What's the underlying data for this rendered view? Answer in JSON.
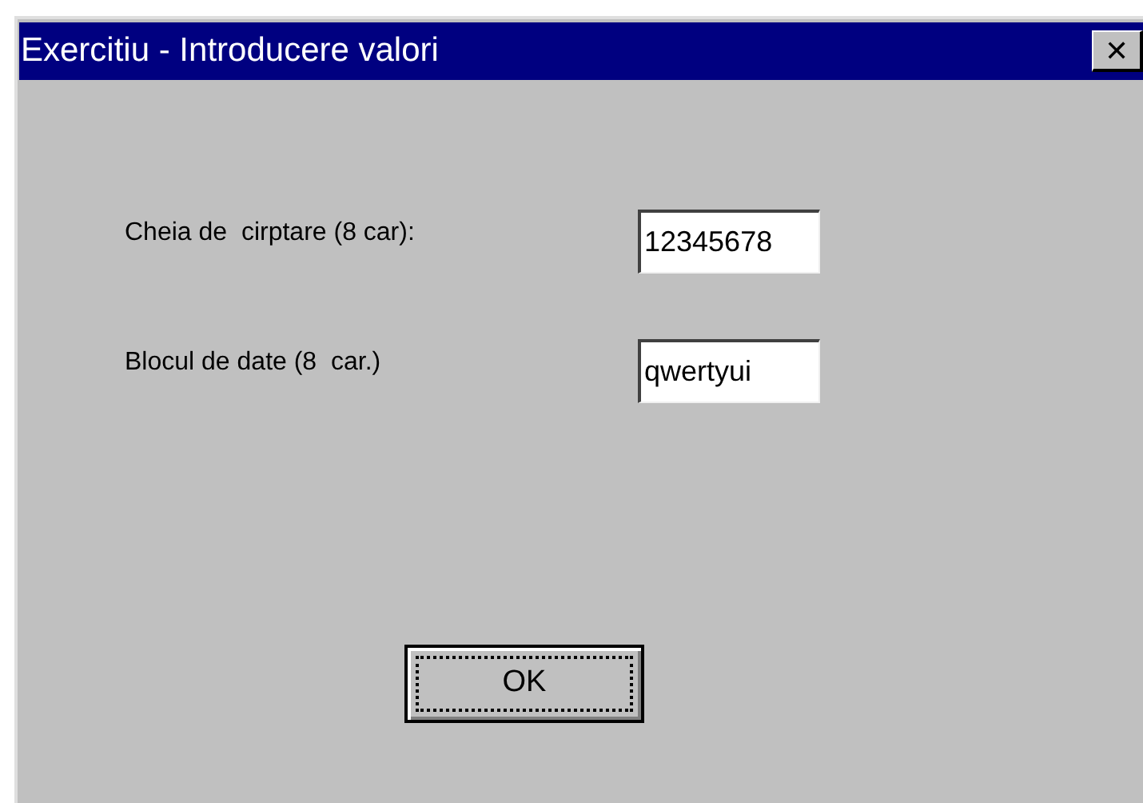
{
  "window": {
    "title": "Exercitiu - Introducere valori",
    "close_glyph": "✕"
  },
  "fields": [
    {
      "label": "Cheia de  cirptare (8 car):",
      "value": "12345678"
    },
    {
      "label": "Blocul de date (8  car.)",
      "value": "qwertyui"
    }
  ],
  "buttons": [
    {
      "label": "OK",
      "focused": true
    }
  ]
}
